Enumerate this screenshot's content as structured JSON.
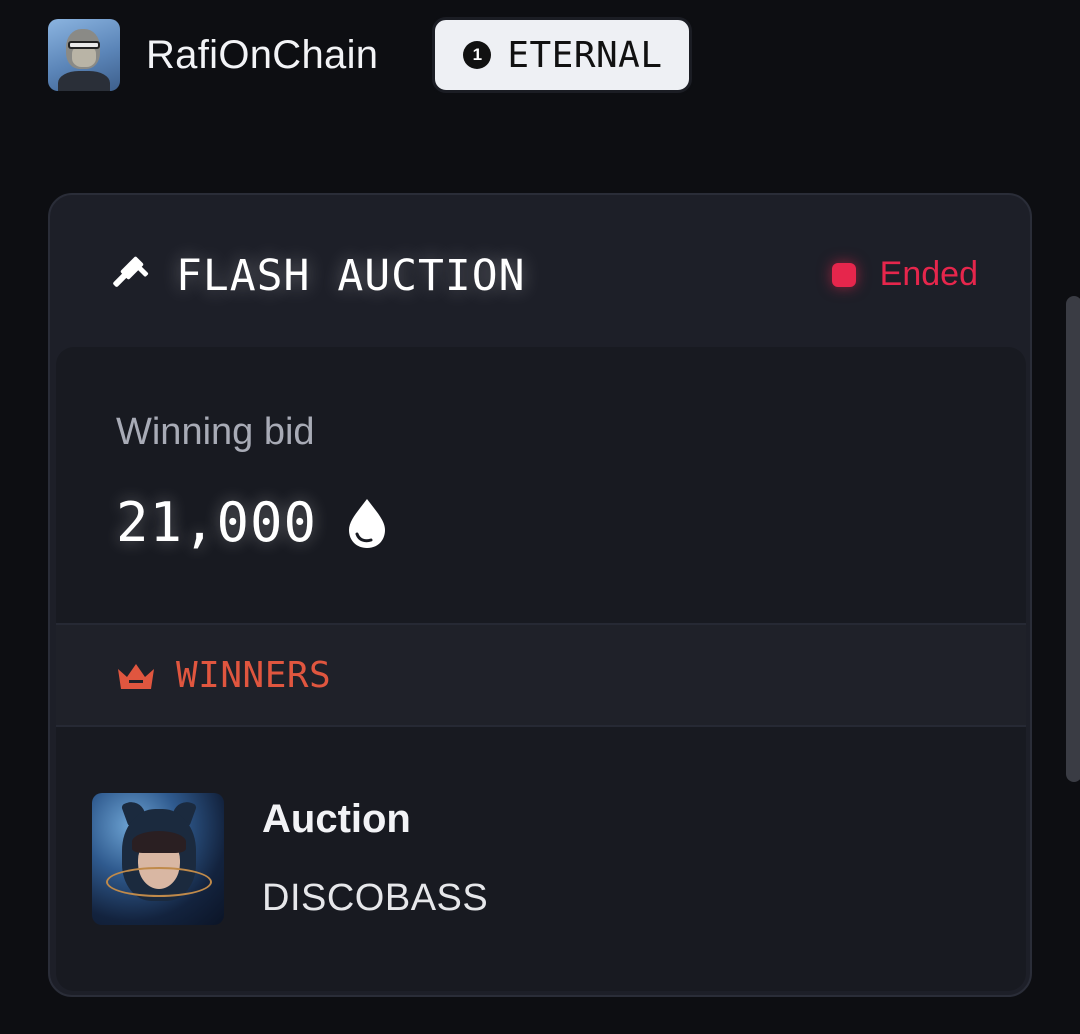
{
  "header": {
    "username": "RafiOnChain",
    "badge": {
      "number": "1",
      "label": "ETERNAL"
    }
  },
  "auction": {
    "title": "FLASH AUCTION",
    "status": "Ended",
    "bid_label": "Winning bid",
    "bid_value": "21,000",
    "winners_title": "WINNERS",
    "winner": {
      "name": "Auction",
      "subtitle": "DISCOBASS"
    }
  },
  "colors": {
    "background": "#0d0e12",
    "status_red": "#e6264c",
    "winners_orange": "#e0563f"
  },
  "icons": [
    "gavel-icon",
    "drop-icon",
    "crown-icon"
  ]
}
